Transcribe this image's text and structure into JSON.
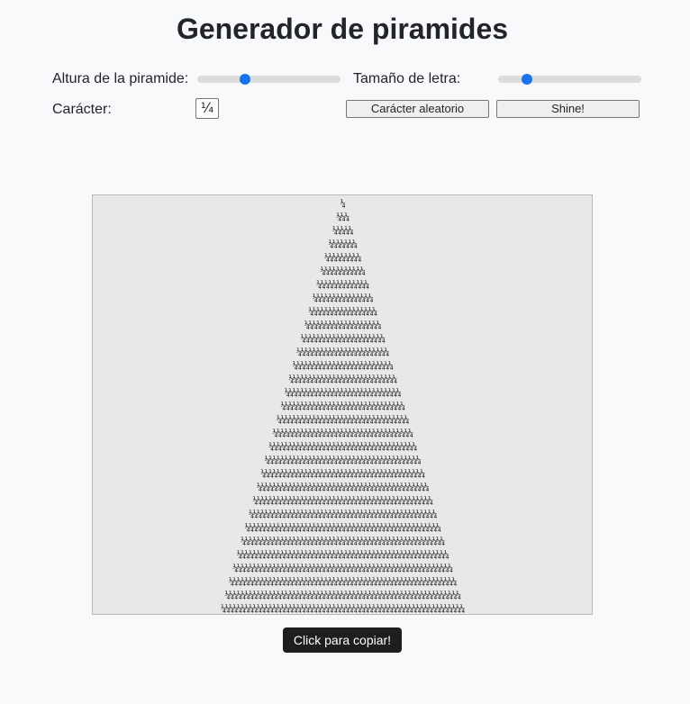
{
  "header": {
    "title": "Generador de piramides"
  },
  "controls": {
    "height_label": "Altura de la piramide:",
    "height_slider_fraction": 0.32,
    "font_size_label": "Tamaño de letra:",
    "font_size_slider_fraction": 0.18,
    "char_label": "Carácter:",
    "char_value": "¼",
    "random_button_label": "Carácter aleatorio",
    "shine_button_label": "Shine!"
  },
  "pyramid": {
    "character": "¼",
    "rows": 31
  },
  "tooltip": {
    "text": "Click para copiar!"
  },
  "colors": {
    "accent": "#1a73e8",
    "pyramid_background": "#e8e8e8",
    "tooltip_background": "#1e1e1e"
  }
}
